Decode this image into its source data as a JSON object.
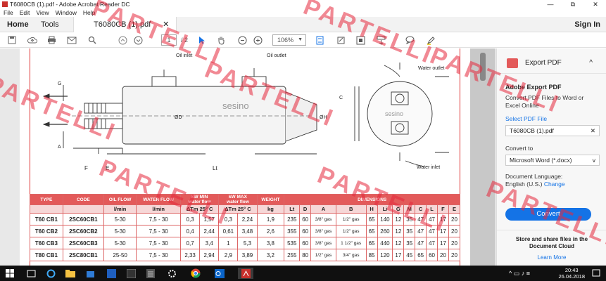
{
  "window": {
    "title": "T6080CB (1).pdf - Adobe Acrobat Reader DC",
    "minimize": "—",
    "maximize": "⧉",
    "close": "✕"
  },
  "menu": [
    "File",
    "Edit",
    "View",
    "Window",
    "Help"
  ],
  "tabs": {
    "home": "Home",
    "tools": "Tools",
    "document": "T6080CB (1).pdf",
    "close": "✕",
    "sign_in": "Sign In"
  },
  "toolbar": {
    "current_page": "1",
    "total_pages": "/ 2",
    "zoom": "106%"
  },
  "drawing": {
    "labels": {
      "oil_inlet": "Oil inlet",
      "oil_outlet": "Oil outlet",
      "water_outlet": "Water outlet",
      "water_inlet": "Water inlet",
      "brand": "sesino",
      "dim_G": "G",
      "dim_A": "A",
      "dim_F": "F",
      "dim_E": "E",
      "dim_Lt": "Lt",
      "dim_D": "ØD",
      "dim_H": "ØH",
      "dim_C": "C"
    }
  },
  "table": {
    "headers": {
      "type": "TYPE",
      "code": "CODE",
      "oil_flow": "OIL FLOW",
      "water_flow": "WATER FLOW",
      "kw_min": "kW MIN",
      "kw_min_sub": "water flow",
      "kw_max": "kW MAX",
      "kw_max_sub": "water flow",
      "weight": "WEIGHT",
      "dimensions": "DIMENSIONS"
    },
    "units": [
      "l/min",
      "l/min",
      "ΔTm 25° C",
      "ΔTm 25° C",
      "kg",
      "Lt",
      "D",
      "A",
      "B",
      "H",
      "Li",
      "G",
      "M",
      "C",
      "L",
      "F",
      "E"
    ],
    "rows": [
      [
        "T60 CB1",
        "2SC60CB1",
        "5-30",
        "7,5 - 30",
        "0,3",
        "1,57",
        "0,3",
        "2,24",
        "1,9",
        "235",
        "60",
        "3/8\" gas",
        "1/2\" gas",
        "65",
        "140",
        "12",
        "35",
        "47",
        "47",
        "17",
        "20"
      ],
      [
        "T60 CB2",
        "2SC60CB2",
        "5-30",
        "7,5 - 30",
        "0,4",
        "2,44",
        "0,61",
        "3,48",
        "2,6",
        "355",
        "60",
        "3/8\" gas",
        "1/2\" gas",
        "65",
        "260",
        "12",
        "35",
        "47",
        "47",
        "17",
        "20"
      ],
      [
        "T60 CB3",
        "2SC60CB3",
        "5-30",
        "7,5 - 30",
        "0,7",
        "3,4",
        "1",
        "5,3",
        "3,8",
        "535",
        "60",
        "3/8\" gas",
        "1 1/2\" gas",
        "65",
        "440",
        "12",
        "35",
        "47",
        "47",
        "17",
        "20"
      ],
      [
        "T80 CB1",
        "2SC80CB1",
        "25-50",
        "7,5 - 30",
        "2,33",
        "2,94",
        "2,9",
        "3,89",
        "3,2",
        "255",
        "80",
        "1/2\" gas",
        "3/4\" gas",
        "85",
        "120",
        "17",
        "45",
        "65",
        "60",
        "20",
        "20"
      ]
    ]
  },
  "export_pane": {
    "header": "Export PDF",
    "chevron": "^",
    "title": "Adobe Export PDF",
    "desc": "Convert PDF Files to Word or Excel Online",
    "select_label": "Select PDF File",
    "file": "T6080CB (1).pdf",
    "file_clear": "✕",
    "convert_to_label": "Convert to",
    "format": "Microsoft Word (*.docx)",
    "format_arrow": "v",
    "lang_label": "Document Language:",
    "lang_value": "English (U.S.)",
    "change": "Change",
    "convert_button": "Convert",
    "store_line1": "Store and share files in the",
    "store_line2": "Document Cloud",
    "learn_more": "Learn More"
  },
  "taskbar": {
    "time": "20:43",
    "date": "26.04.2018"
  },
  "watermark": "PARTELLI",
  "colors": {
    "accent": "#1473e6",
    "table_header": "#e35a5a",
    "watermark": "#e6283c",
    "taskbar": "#101010"
  }
}
